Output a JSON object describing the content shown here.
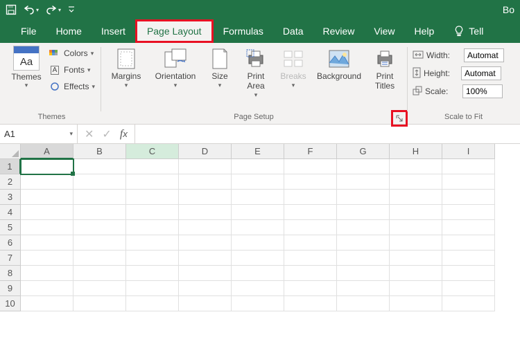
{
  "titlebar": {
    "doc_partial": "Bo"
  },
  "tabs": {
    "file": "File",
    "home": "Home",
    "insert": "Insert",
    "page_layout": "Page Layout",
    "formulas": "Formulas",
    "data": "Data",
    "review": "Review",
    "view": "View",
    "help": "Help",
    "tell": "Tell"
  },
  "ribbon": {
    "themes": {
      "label": "Themes",
      "swatch_text": "Aa",
      "themes_btn": "Themes",
      "colors": "Colors",
      "fonts": "Fonts",
      "effects": "Effects"
    },
    "page_setup": {
      "label": "Page Setup",
      "margins": "Margins",
      "orientation": "Orientation",
      "size": "Size",
      "print_area": "Print\nArea",
      "breaks": "Breaks",
      "background": "Background",
      "print_titles": "Print\nTitles"
    },
    "scale": {
      "label": "Scale to Fit",
      "width": "Width:",
      "height": "Height:",
      "scale": "Scale:",
      "width_val": "Automat",
      "height_val": "Automat",
      "scale_val": "100%"
    }
  },
  "fx": {
    "namebox": "A1"
  },
  "grid": {
    "cols": [
      "A",
      "B",
      "C",
      "D",
      "E",
      "F",
      "G",
      "H",
      "I"
    ],
    "rows": [
      "1",
      "2",
      "3",
      "4",
      "5",
      "6",
      "7",
      "8",
      "9",
      "10"
    ],
    "active_col": "A",
    "hint_col": "C",
    "active_row": "1"
  }
}
